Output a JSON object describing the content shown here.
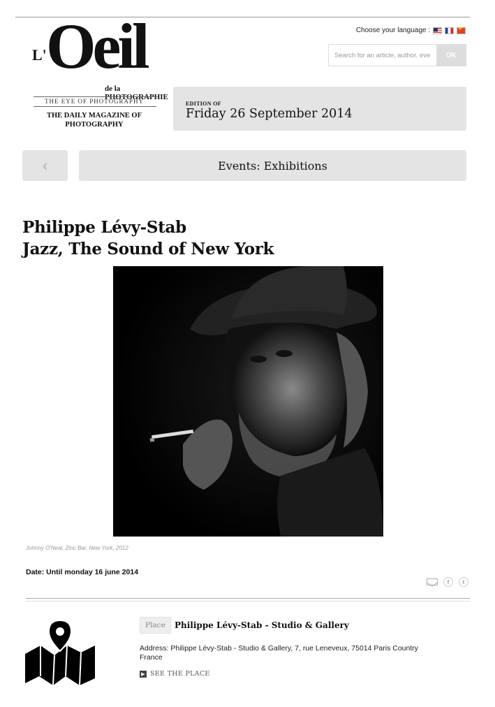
{
  "logo": {
    "letter": "L'",
    "main": "Oeil",
    "dela": "de la PHOTOGRAPHIE",
    "tagline": "THE EYE OF PHOTOGRAPHY",
    "subtitle": "THE DAILY MAGAZINE OF PHOTOGRAPHY"
  },
  "header": {
    "language_label": "Choose your language :",
    "flags": [
      "us-flag",
      "fr-flag",
      "cn-flag"
    ],
    "search_placeholder": "Search for an article, author, event...",
    "search_button": "OK"
  },
  "edition": {
    "label": "EDITION OF",
    "date": "Friday 26 September 2014"
  },
  "nav": {
    "back_icon": "chevron-left-icon",
    "section": "Events: Exhibitions"
  },
  "article": {
    "title_line1": "Philippe Lévy-Stab",
    "title_line2": "Jazz, The Sound of New York",
    "photo_caption": "Johnny O'Neal, Zinc Bar, New York, 2012",
    "date_text": "Date: Until monday 16 june 2014"
  },
  "share": {
    "icons": [
      "mail-icon",
      "facebook-icon",
      "twitter-icon"
    ],
    "facebook_glyph": "f",
    "twitter_glyph": "t"
  },
  "place": {
    "tag": "Place",
    "name": "Philippe Lévy-Stab - Studio & Gallery",
    "address": "Address: Philippe Lévy-Stab - Studio & Gallery, 7, rue Leneveux, 75014 Paris Country France",
    "link": "SEE THE PLACE"
  }
}
